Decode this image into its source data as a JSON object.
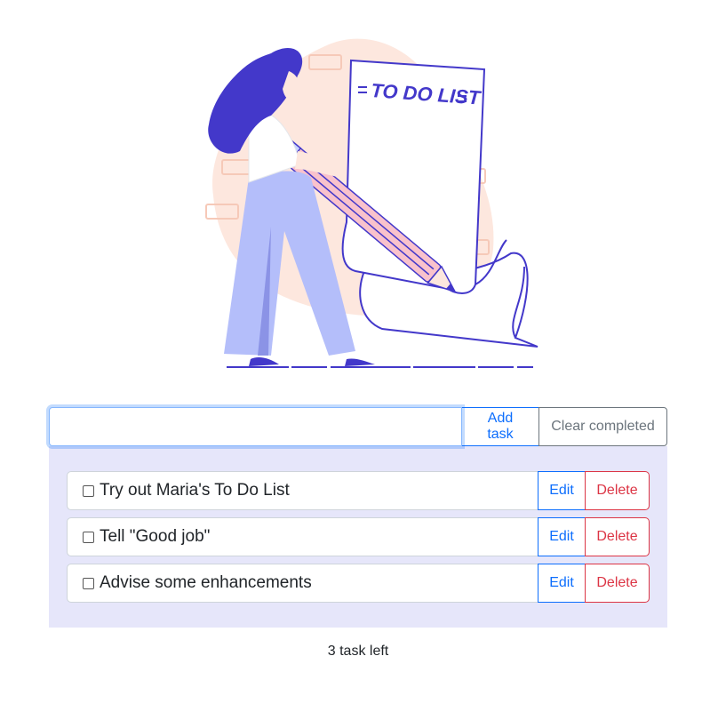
{
  "hero": {
    "illustration": "woman-writing-todo-list-illustration",
    "sign_text": "TO DO LIST"
  },
  "input": {
    "value": "",
    "placeholder": ""
  },
  "buttons": {
    "add_label": "Add task",
    "clear_label": "Clear completed"
  },
  "tasks": [
    {
      "label": "Try out Maria's To Do List",
      "checked": false,
      "edit_label": "Edit",
      "delete_label": "Delete"
    },
    {
      "label": "Tell \"Good job\"",
      "checked": false,
      "edit_label": "Edit",
      "delete_label": "Delete"
    },
    {
      "label": "Advise some enhancements",
      "checked": false,
      "edit_label": "Edit",
      "delete_label": "Delete"
    }
  ],
  "footer": {
    "tasks_left": "3 task left"
  },
  "colors": {
    "primary": "#0d6efd",
    "danger": "#dc3545",
    "secondary": "#6c757d",
    "panel_bg": "#e6e6fa",
    "illustration_accent": "#4338ca"
  }
}
